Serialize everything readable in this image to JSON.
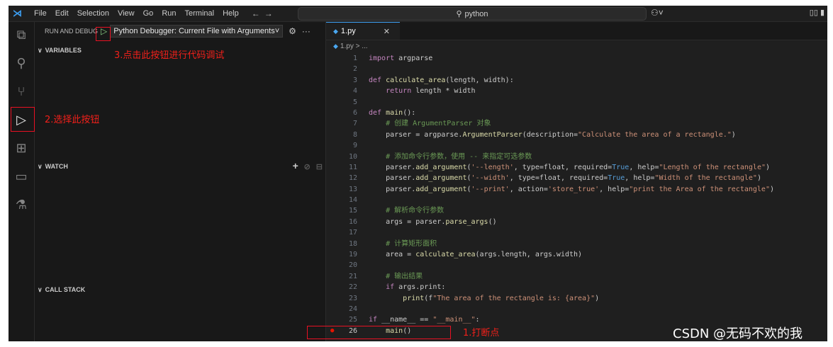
{
  "titlebar": {
    "menus": [
      "File",
      "Edit",
      "Selection",
      "View",
      "Go",
      "Run",
      "Terminal",
      "Help"
    ],
    "search_text": "python"
  },
  "sidebar": {
    "header_label": "RUN AND DEBUG",
    "config_label": "Python Debugger: Current File with Arguments",
    "variables_label": "VARIABLES",
    "watch_label": "WATCH",
    "callstack_label": "CALL STACK"
  },
  "editor": {
    "tab_label": "1.py",
    "breadcrumb": "1.py > ...",
    "lines": [
      {
        "n": "1",
        "code": "import argparse"
      },
      {
        "n": "2",
        "code": ""
      },
      {
        "n": "3",
        "code": "def calculate_area(length, width):"
      },
      {
        "n": "4",
        "code": "    return length * width"
      },
      {
        "n": "5",
        "code": ""
      },
      {
        "n": "6",
        "code": "def main():"
      },
      {
        "n": "7",
        "code": "    # 创建 ArgumentParser 对象"
      },
      {
        "n": "8",
        "code": "    parser = argparse.ArgumentParser(description=\"Calculate the area of a rectangle.\")"
      },
      {
        "n": "9",
        "code": ""
      },
      {
        "n": "10",
        "code": "    # 添加命令行参数，使用 -- 来指定可选参数"
      },
      {
        "n": "11",
        "code": "    parser.add_argument('--length', type=float, required=True, help=\"Length of the rectangle\")"
      },
      {
        "n": "12",
        "code": "    parser.add_argument('--width', type=float, required=True, help=\"Width of the rectangle\")"
      },
      {
        "n": "13",
        "code": "    parser.add_argument('--print', action='store_true', help=\"print the Area of the rectangle\")"
      },
      {
        "n": "14",
        "code": ""
      },
      {
        "n": "15",
        "code": "    # 解析命令行参数"
      },
      {
        "n": "16",
        "code": "    args = parser.parse_args()"
      },
      {
        "n": "17",
        "code": ""
      },
      {
        "n": "18",
        "code": "    # 计算矩形面积"
      },
      {
        "n": "19",
        "code": "    area = calculate_area(args.length, args.width)"
      },
      {
        "n": "20",
        "code": ""
      },
      {
        "n": "21",
        "code": "    # 输出结果"
      },
      {
        "n": "22",
        "code": "    if args.print:"
      },
      {
        "n": "23",
        "code": "        print(f\"The area of the rectangle is: {area}\")"
      },
      {
        "n": "24",
        "code": ""
      },
      {
        "n": "25",
        "code": "if __name__ == \"__main__\":"
      },
      {
        "n": "26",
        "code": "    main()"
      }
    ]
  },
  "annotations": {
    "step1": "1.打断点",
    "step2": "2.选择此按钮",
    "step3": "3.点击此按钮进行代码调试"
  },
  "watermark": "CSDN @无码不欢的我"
}
